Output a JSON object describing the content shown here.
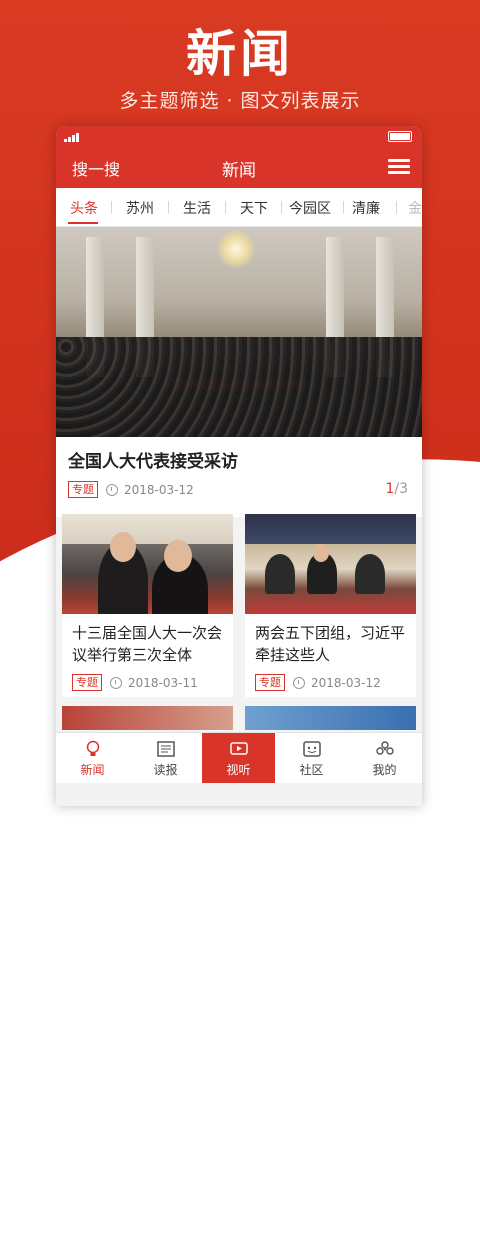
{
  "promo": {
    "title": "新闻",
    "subtitle": "多主题筛选 · 图文列表展示"
  },
  "app": {
    "search_label": "搜一搜",
    "title": "新闻"
  },
  "tabs": [
    "头条",
    "苏州",
    "生活",
    "天下",
    "今园区",
    "清廉",
    "金"
  ],
  "lead": {
    "title": "全国人大代表接受采访",
    "tag": "专题",
    "date": "2018-03-12",
    "pager_current": "1",
    "pager_total": "/3"
  },
  "cards": [
    {
      "title": "十三届全国人大一次会议举行第三次全体",
      "tag": "专题",
      "date": "2018-03-11"
    },
    {
      "title": "两会五下团组，习近平牵挂这些人",
      "tag": "专题",
      "date": "2018-03-12"
    }
  ],
  "bottom_nav": [
    {
      "label": "新闻",
      "icon": "bulb-icon"
    },
    {
      "label": "读报",
      "icon": "newspaper-icon"
    },
    {
      "label": "视听",
      "icon": "video-icon"
    },
    {
      "label": "社区",
      "icon": "community-icon"
    },
    {
      "label": "我的",
      "icon": "profile-icon"
    }
  ],
  "colors": {
    "accent": "#d8342a"
  }
}
